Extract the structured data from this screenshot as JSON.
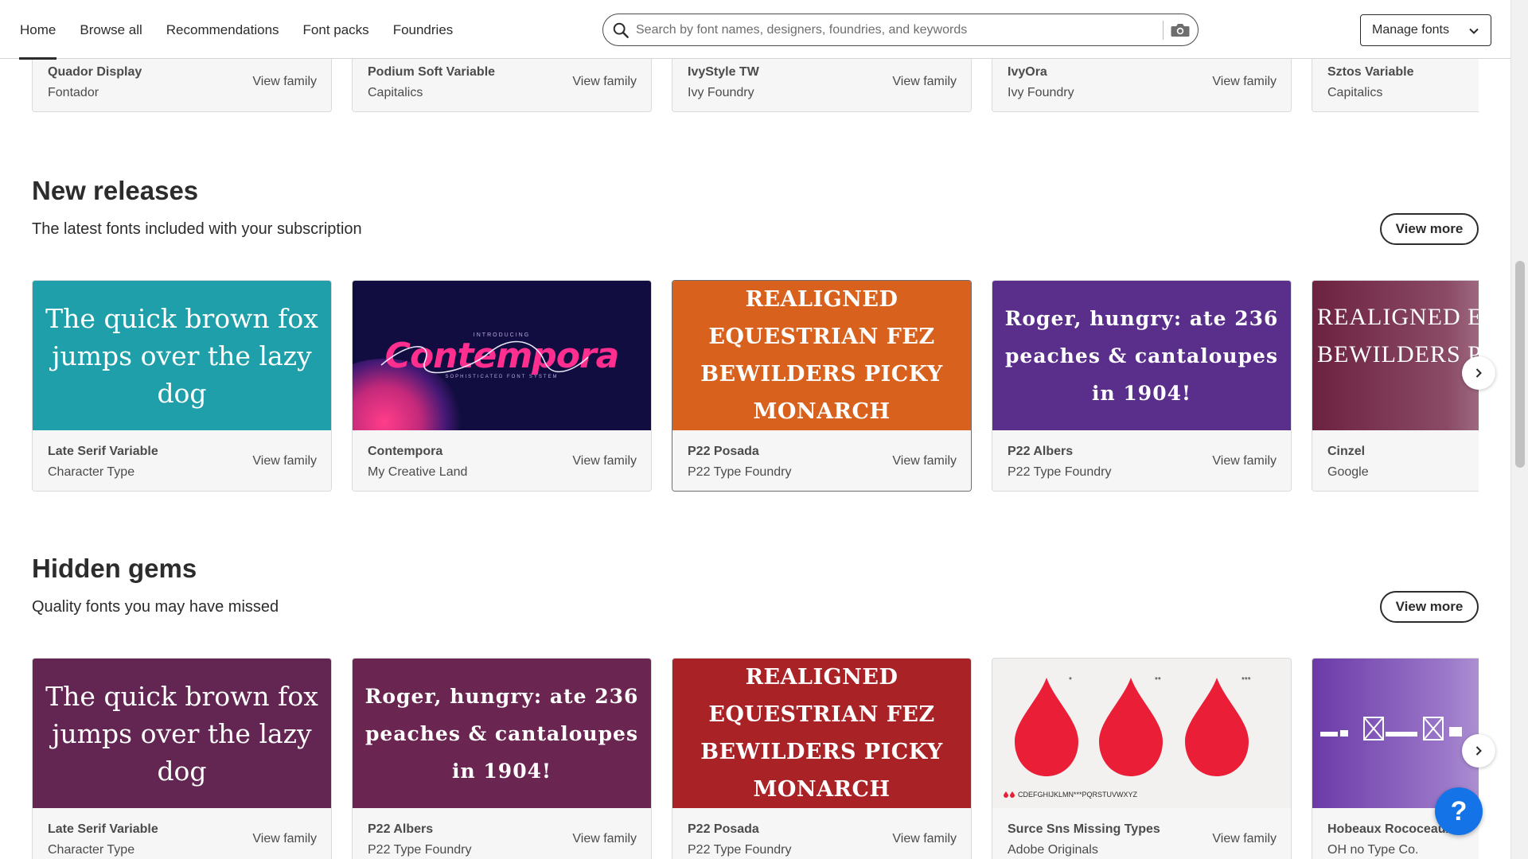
{
  "nav": {
    "items": [
      "Home",
      "Browse all",
      "Recommendations",
      "Font packs",
      "Foundries"
    ],
    "active": "Home"
  },
  "search": {
    "placeholder": "Search by font names, designers, foundries, and keywords",
    "value": ""
  },
  "manage_fonts": {
    "label": "Manage fonts"
  },
  "top_row": [
    {
      "name": "Quador Display",
      "foundry": "Fontador",
      "link": "View family"
    },
    {
      "name": "Podium Soft Variable",
      "foundry": "Capitalics",
      "link": "View family"
    },
    {
      "name": "IvyStyle TW",
      "foundry": "Ivy Foundry",
      "link": "View family"
    },
    {
      "name": "IvyOra",
      "foundry": "Ivy Foundry",
      "link": "View family"
    },
    {
      "name": "Sztos Variable",
      "foundry": "Capitalics",
      "link": ""
    }
  ],
  "new_releases": {
    "title": "New releases",
    "subtitle": "The latest fonts included with your subscription",
    "view_more": "View more",
    "cards": [
      {
        "name": "Late Serif Variable",
        "foundry": "Character Type",
        "link": "View family",
        "sample": "The quick brown fox jumps over the lazy dog",
        "bg": "#1f9fa9"
      },
      {
        "name": "Contempora",
        "foundry": "My Creative Land",
        "link": "View family",
        "sample": "Contempora",
        "sample_top": "INTRODUCING",
        "sample_bottom": "SOPHISTICATED FONT SYSTEM",
        "bg": "#120d40"
      },
      {
        "name": "P22 Posada",
        "foundry": "P22 Type Foundry",
        "link": "View family",
        "sample": "Realigned equestrian fez bewilders picky monarch",
        "bg": "#d8621d"
      },
      {
        "name": "P22 Albers",
        "foundry": "P22 Type Foundry",
        "link": "View family",
        "sample": "Roger, hungry: ate 236 peaches & cantaloupes in 1904!",
        "bg": "#5a2f8c"
      },
      {
        "name": "Cinzel",
        "foundry": "Google",
        "link": "",
        "sample": "Realigned equestrian fez bewilders picky monarch",
        "bg": "#6c2240"
      }
    ]
  },
  "hidden_gems": {
    "title": "Hidden gems",
    "subtitle": "Quality fonts you may have missed",
    "view_more": "View more",
    "cards": [
      {
        "name": "Late Serif Variable",
        "foundry": "Character Type",
        "link": "View family",
        "sample": "The quick brown fox jumps over the lazy dog",
        "bg": "#632552"
      },
      {
        "name": "P22 Albers",
        "foundry": "P22 Type Foundry",
        "link": "View family",
        "sample": "Roger, hungry: ate 236 peaches & cantaloupes in 1904!",
        "bg": "#6a2651"
      },
      {
        "name": "P22 Posada",
        "foundry": "P22 Type Foundry",
        "link": "View family",
        "sample": "Realigned equestrian fez bewilders picky monarch",
        "bg": "#a82226"
      },
      {
        "name": "Surce Sns Missing Types",
        "foundry": "Adobe Originals",
        "link": "View family",
        "sample_line": "CDEFGHIJKLMN***PQRSTUVWXYZ",
        "marks": [
          "*",
          "**",
          "***"
        ],
        "bg": "#f3f0f0",
        "drop_color": "#ea1e37"
      },
      {
        "name": "Hobeaux Rococeaux",
        "foundry": "OH no Type Co.",
        "link": "",
        "bg": "#6b3aa8"
      }
    ]
  },
  "help": {
    "label": "?"
  },
  "colors": {
    "accent": "#1473e6",
    "text": "#2c2c2c"
  }
}
